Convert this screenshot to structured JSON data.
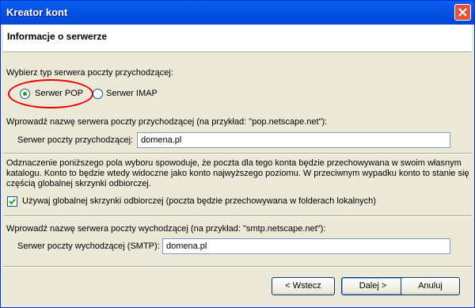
{
  "window": {
    "title": "Kreator kont"
  },
  "header": {
    "title": "Informacje o serwerze"
  },
  "incoming_type": {
    "prompt": "Wybierz typ serwera poczty przychodzącej:",
    "options": [
      "Serwer POP",
      "Serwer IMAP"
    ],
    "selected": "Serwer POP"
  },
  "incoming_server": {
    "prompt": "Wprowadź nazwę serwera poczty przychodzącej (na przykład: \"pop.netscape.net\"):",
    "label": "Serwer poczty przychodzącej:",
    "value": "domena.pl"
  },
  "inbox_note": {
    "line1": "Odznaczenie poniższego pola wyboru spowoduje, że poczta dla tego konta będzie przechowywana w swoim własnym",
    "line2": "katalogu. Konto to będzie wtedy widoczne jako konto najwyższego poziomu. W przeciwnym wypadku konto to stanie się",
    "line3": "częścią globalnej skrzynki odbiorczej.",
    "checkbox_label": "Używaj globalnej skrzynki odbiorczej (poczta będzie przechowywana w folderach lokalnych)",
    "checked": true
  },
  "outgoing_server": {
    "prompt": "Wprowadź nazwę serwera poczty wychodzącej (na przykład: \"smtp.netscape.net\"):",
    "label": "Serwer poczty wychodzącej (SMTP):",
    "value": "domena.pl"
  },
  "buttons": {
    "back": "< Wstecz",
    "next": "Dalej >",
    "cancel": "Anuluj"
  },
  "colors": {
    "titlebar": "#0554e3",
    "highlight": "#e60000",
    "dialog_bg": "#ece9d8"
  }
}
